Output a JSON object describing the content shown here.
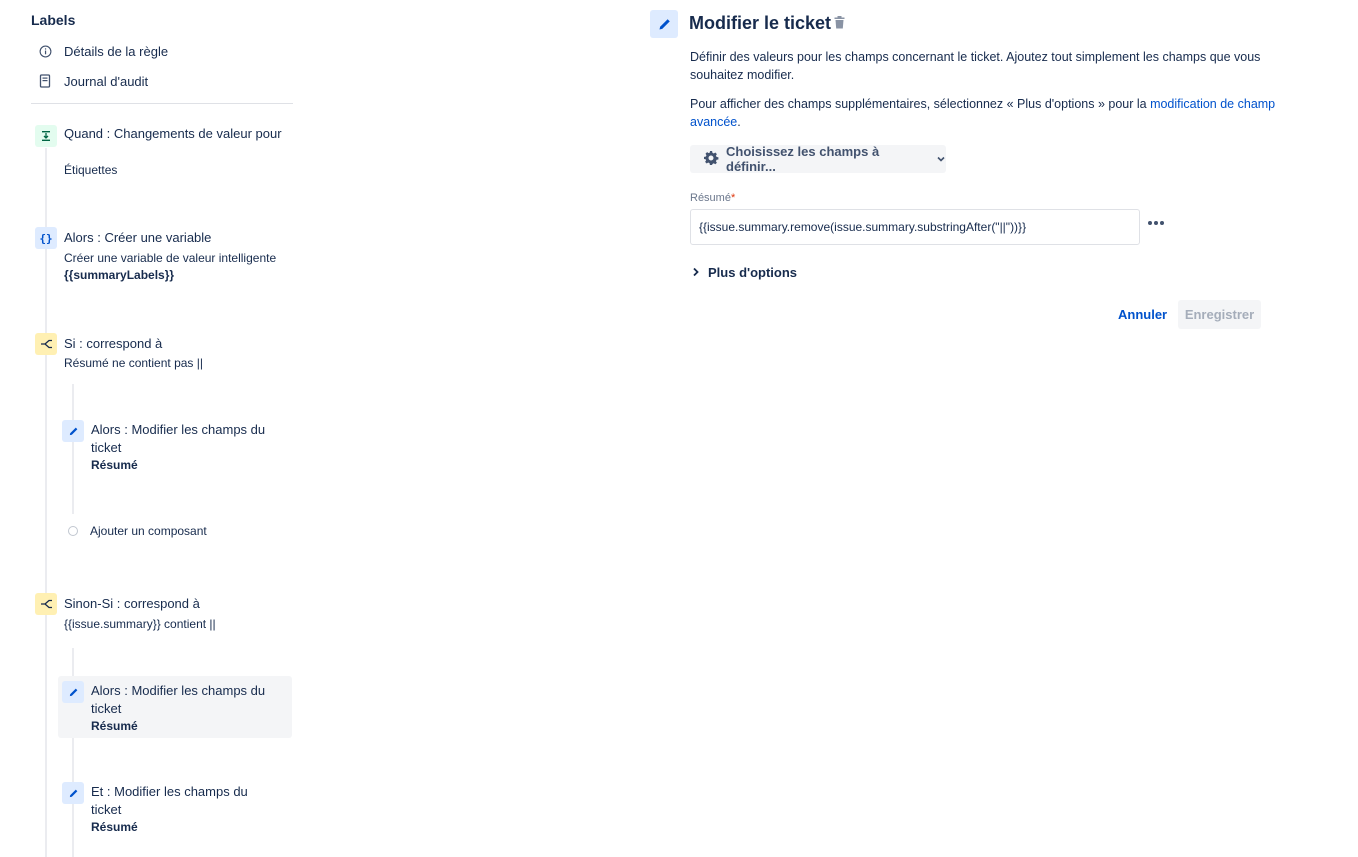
{
  "sidebar": {
    "title": "Labels",
    "links": [
      {
        "label": "Détails de la règle",
        "icon": "info-icon"
      },
      {
        "label": "Journal d'audit",
        "icon": "audit-log-icon"
      }
    ],
    "steps": [
      {
        "title": "Quand : Changements de valeur pour",
        "subtitle": "Étiquettes",
        "icon": "trigger-icon",
        "kind": "trigger"
      },
      {
        "title": "Alors : Créer une variable",
        "subtitle": "Créer une variable de valeur intelligente",
        "subtitle_strong": "{{summaryLabels}}",
        "icon": "variable-icon",
        "kind": "action"
      },
      {
        "title": "Si : correspond à",
        "subtitle": "Résumé ne contient pas ||",
        "icon": "condition-icon",
        "kind": "condition"
      },
      {
        "title": "Alors : Modifier les champs du ticket",
        "subtitle_strong": "Résumé",
        "icon": "pencil-icon",
        "kind": "action"
      },
      {
        "title": "Sinon-Si : correspond à",
        "subtitle": "{{issue.summary}} contient ||",
        "icon": "condition-icon",
        "kind": "condition"
      },
      {
        "title": "Alors : Modifier les champs du ticket",
        "subtitle_strong": "Résumé",
        "icon": "pencil-icon",
        "kind": "action",
        "selected": true
      },
      {
        "title": "Et : Modifier les champs du ticket",
        "subtitle_strong": "Résumé",
        "icon": "pencil-icon",
        "kind": "action"
      }
    ],
    "add_component": "Ajouter un composant"
  },
  "main": {
    "title": "Modifier le ticket",
    "desc1": "Définir des valeurs pour les champs concernant le ticket. Ajoutez tout simplement les champs que vous souhaitez modifier.",
    "desc2_prefix": "Pour afficher des champs supplémentaires, sélectionnez « Plus d'options » pour la ",
    "desc2_link": "modification de champ avancée",
    "desc2_suffix": ".",
    "choose_fields": "Choisissez les champs à définir...",
    "field_label": "Résumé",
    "field_required": "*",
    "field_value": "{{issue.summary.remove(issue.summary.substringAfter(\"||\"))}}",
    "more_options": "Plus d'options",
    "cancel": "Annuler",
    "save": "Enregistrer"
  },
  "colors": {
    "text": "#172b4d",
    "link": "#0052cc",
    "trigger_bg": "#e3fcef",
    "action_bg": "#deebff",
    "condition_bg": "#fff0b3",
    "selected_bg": "#f4f5f7",
    "disabled_text": "#a5adba"
  }
}
